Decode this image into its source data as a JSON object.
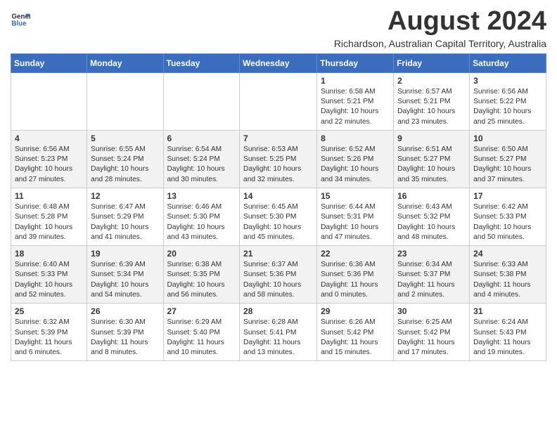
{
  "logo": {
    "line1": "General",
    "line2": "Blue"
  },
  "title": "August 2024",
  "subtitle": "Richardson, Australian Capital Territory, Australia",
  "days_of_week": [
    "Sunday",
    "Monday",
    "Tuesday",
    "Wednesday",
    "Thursday",
    "Friday",
    "Saturday"
  ],
  "weeks": [
    [
      {
        "day": "",
        "info": ""
      },
      {
        "day": "",
        "info": ""
      },
      {
        "day": "",
        "info": ""
      },
      {
        "day": "",
        "info": ""
      },
      {
        "day": "1",
        "info": "Sunrise: 6:58 AM\nSunset: 5:21 PM\nDaylight: 10 hours\nand 22 minutes."
      },
      {
        "day": "2",
        "info": "Sunrise: 6:57 AM\nSunset: 5:21 PM\nDaylight: 10 hours\nand 23 minutes."
      },
      {
        "day": "3",
        "info": "Sunrise: 6:56 AM\nSunset: 5:22 PM\nDaylight: 10 hours\nand 25 minutes."
      }
    ],
    [
      {
        "day": "4",
        "info": "Sunrise: 6:56 AM\nSunset: 5:23 PM\nDaylight: 10 hours\nand 27 minutes."
      },
      {
        "day": "5",
        "info": "Sunrise: 6:55 AM\nSunset: 5:24 PM\nDaylight: 10 hours\nand 28 minutes."
      },
      {
        "day": "6",
        "info": "Sunrise: 6:54 AM\nSunset: 5:24 PM\nDaylight: 10 hours\nand 30 minutes."
      },
      {
        "day": "7",
        "info": "Sunrise: 6:53 AM\nSunset: 5:25 PM\nDaylight: 10 hours\nand 32 minutes."
      },
      {
        "day": "8",
        "info": "Sunrise: 6:52 AM\nSunset: 5:26 PM\nDaylight: 10 hours\nand 34 minutes."
      },
      {
        "day": "9",
        "info": "Sunrise: 6:51 AM\nSunset: 5:27 PM\nDaylight: 10 hours\nand 35 minutes."
      },
      {
        "day": "10",
        "info": "Sunrise: 6:50 AM\nSunset: 5:27 PM\nDaylight: 10 hours\nand 37 minutes."
      }
    ],
    [
      {
        "day": "11",
        "info": "Sunrise: 6:48 AM\nSunset: 5:28 PM\nDaylight: 10 hours\nand 39 minutes."
      },
      {
        "day": "12",
        "info": "Sunrise: 6:47 AM\nSunset: 5:29 PM\nDaylight: 10 hours\nand 41 minutes."
      },
      {
        "day": "13",
        "info": "Sunrise: 6:46 AM\nSunset: 5:30 PM\nDaylight: 10 hours\nand 43 minutes."
      },
      {
        "day": "14",
        "info": "Sunrise: 6:45 AM\nSunset: 5:30 PM\nDaylight: 10 hours\nand 45 minutes."
      },
      {
        "day": "15",
        "info": "Sunrise: 6:44 AM\nSunset: 5:31 PM\nDaylight: 10 hours\nand 47 minutes."
      },
      {
        "day": "16",
        "info": "Sunrise: 6:43 AM\nSunset: 5:32 PM\nDaylight: 10 hours\nand 48 minutes."
      },
      {
        "day": "17",
        "info": "Sunrise: 6:42 AM\nSunset: 5:33 PM\nDaylight: 10 hours\nand 50 minutes."
      }
    ],
    [
      {
        "day": "18",
        "info": "Sunrise: 6:40 AM\nSunset: 5:33 PM\nDaylight: 10 hours\nand 52 minutes."
      },
      {
        "day": "19",
        "info": "Sunrise: 6:39 AM\nSunset: 5:34 PM\nDaylight: 10 hours\nand 54 minutes."
      },
      {
        "day": "20",
        "info": "Sunrise: 6:38 AM\nSunset: 5:35 PM\nDaylight: 10 hours\nand 56 minutes."
      },
      {
        "day": "21",
        "info": "Sunrise: 6:37 AM\nSunset: 5:36 PM\nDaylight: 10 hours\nand 58 minutes."
      },
      {
        "day": "22",
        "info": "Sunrise: 6:36 AM\nSunset: 5:36 PM\nDaylight: 11 hours\nand 0 minutes."
      },
      {
        "day": "23",
        "info": "Sunrise: 6:34 AM\nSunset: 5:37 PM\nDaylight: 11 hours\nand 2 minutes."
      },
      {
        "day": "24",
        "info": "Sunrise: 6:33 AM\nSunset: 5:38 PM\nDaylight: 11 hours\nand 4 minutes."
      }
    ],
    [
      {
        "day": "25",
        "info": "Sunrise: 6:32 AM\nSunset: 5:39 PM\nDaylight: 11 hours\nand 6 minutes."
      },
      {
        "day": "26",
        "info": "Sunrise: 6:30 AM\nSunset: 5:39 PM\nDaylight: 11 hours\nand 8 minutes."
      },
      {
        "day": "27",
        "info": "Sunrise: 6:29 AM\nSunset: 5:40 PM\nDaylight: 11 hours\nand 10 minutes."
      },
      {
        "day": "28",
        "info": "Sunrise: 6:28 AM\nSunset: 5:41 PM\nDaylight: 11 hours\nand 13 minutes."
      },
      {
        "day": "29",
        "info": "Sunrise: 6:26 AM\nSunset: 5:42 PM\nDaylight: 11 hours\nand 15 minutes."
      },
      {
        "day": "30",
        "info": "Sunrise: 6:25 AM\nSunset: 5:42 PM\nDaylight: 11 hours\nand 17 minutes."
      },
      {
        "day": "31",
        "info": "Sunrise: 6:24 AM\nSunset: 5:43 PM\nDaylight: 11 hours\nand 19 minutes."
      }
    ]
  ]
}
